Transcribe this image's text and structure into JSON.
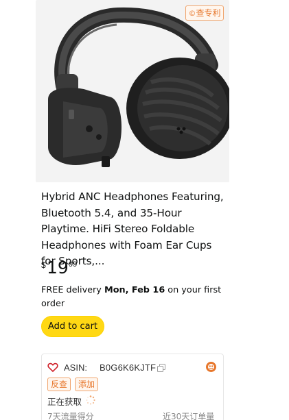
{
  "product": {
    "image_alt": "Hybrid ANC headphones",
    "patent_badge": "查专利",
    "title": "Hybrid ANC Headphones Featuring, Bluetooth 5.4, and 35-Hour Playtime. HiFi Stereo Foldable Headphones with Foam Ear Cups for Sports,...",
    "price": {
      "symbol": "$",
      "whole": "19",
      "fraction": "99"
    },
    "delivery": {
      "prefix": "FREE delivery ",
      "date": "Mon, Feb 16",
      "suffix": " on your first order"
    },
    "add_to_cart": "Add to cart"
  },
  "extension": {
    "asin_label": "ASIN:",
    "asin_value": "B0G6K6KJTF",
    "tags": [
      "反查",
      "添加"
    ],
    "loading_text": "正在获取",
    "metric_left": "7天流量得分",
    "metric_right": "近30天订单量"
  },
  "colors": {
    "accent_orange": "#e7772c",
    "cart_yellow": "#ffd814",
    "heart_red": "#d0232c"
  }
}
